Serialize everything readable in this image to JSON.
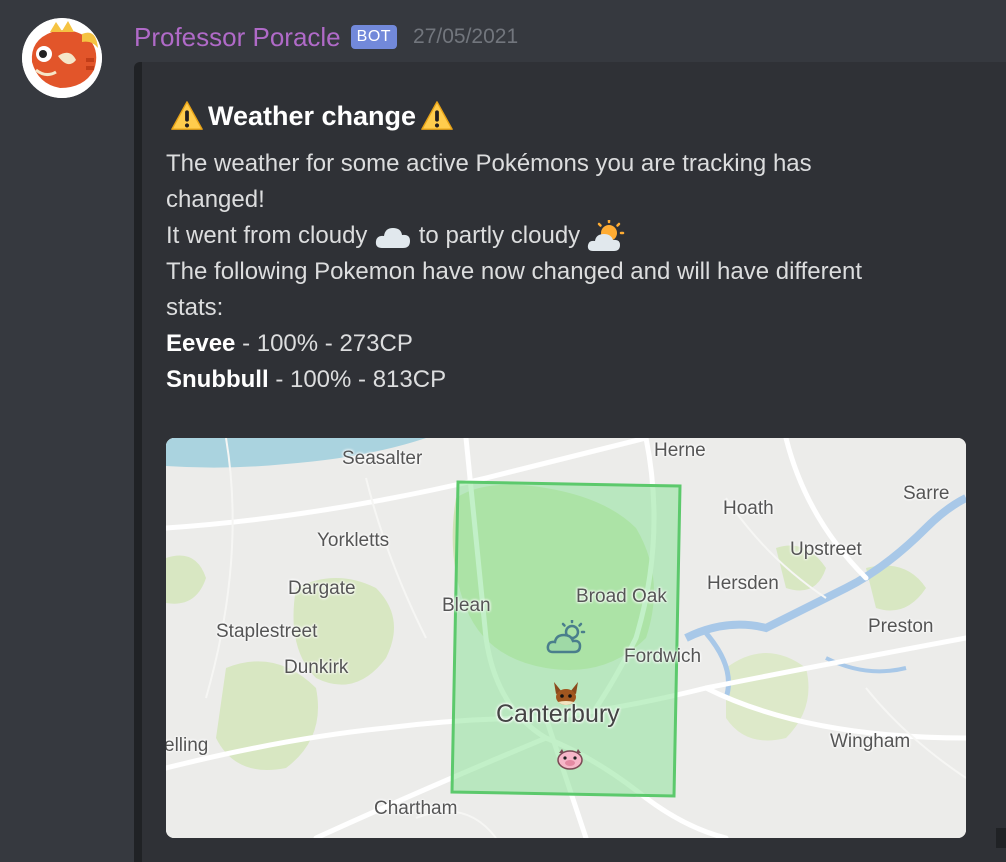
{
  "message": {
    "author": "Professor Poracle",
    "badge": "BOT",
    "timestamp": "27/05/2021",
    "avatar_icon": "magikarp-avatar-icon"
  },
  "embed": {
    "title": "Weather change",
    "title_icon": "warning-icon",
    "desc_line1": "The weather for some active Pokémons you are tracking has",
    "desc_line2": "changed!",
    "from_prefix": "It went from cloudy",
    "to_text": "to partly cloudy",
    "from_icon": "cloud-icon",
    "to_icon": "partly-cloudy-icon",
    "desc_line4": "The following Pokemon have now changed and will have different",
    "desc_line5": "stats:",
    "pokemon": [
      {
        "name": "Eevee",
        "detail": " - 100% - 273CP"
      },
      {
        "name": "Snubbull",
        "detail": " - 100% - 813CP"
      }
    ]
  },
  "map": {
    "places": {
      "seasalter": "Seasalter",
      "herne": "Herne",
      "sarre": "Sarre",
      "hoath": "Hoath",
      "yorkletts": "Yorkletts",
      "upstreet": "Upstreet",
      "dargate": "Dargate",
      "blean": "Blean",
      "broad_oak": "Broad Oak",
      "hersden": "Hersden",
      "staplestreet": "Staplestreet",
      "preston": "Preston",
      "fordwich": "Fordwich",
      "dunkirk": "Dunkirk",
      "canterbury": "Canterbury",
      "elling": "elling",
      "wingham": "Wingham",
      "chartham": "Chartham"
    },
    "colors": {
      "area_fill": "#8fe39a",
      "area_stroke": "#5cc96c",
      "land": "#ececea",
      "woods": "#d5e5be",
      "water": "#a8c8e8"
    },
    "weather_icon": "partly-cloudy-icon",
    "pokemon_icons": [
      "eevee-icon",
      "snubbull-icon"
    ]
  }
}
